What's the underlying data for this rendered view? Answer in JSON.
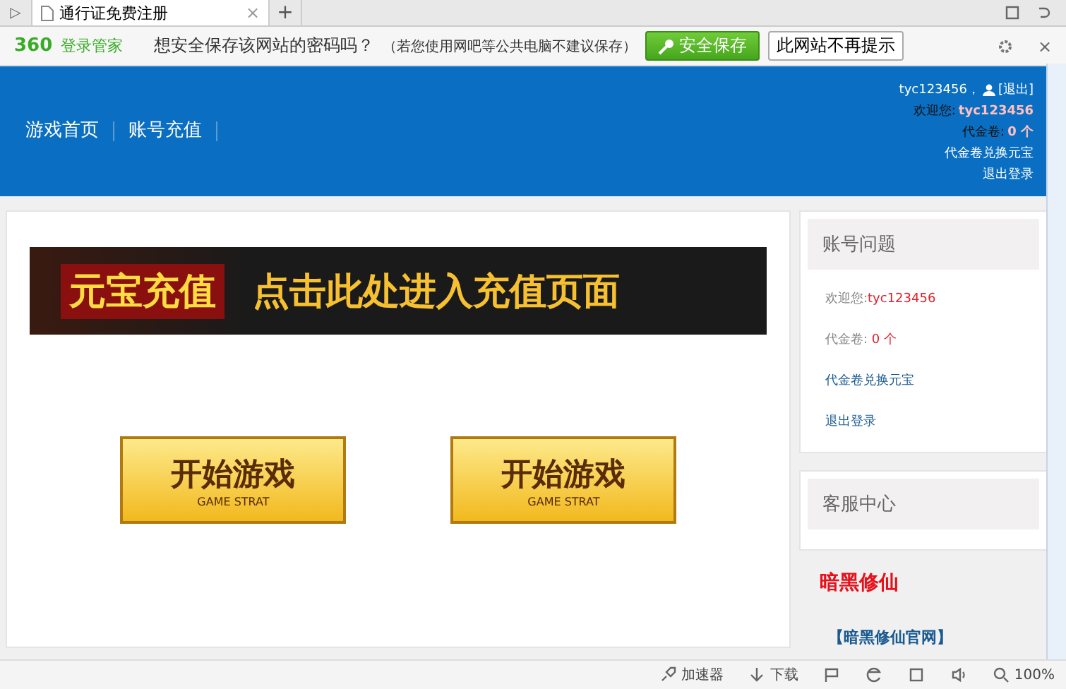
{
  "browser_tab": {
    "sidebar_toggle": "▷",
    "title": "通行证免费注册",
    "close": "×",
    "new_tab": "+"
  },
  "password_bar": {
    "brand_number": "360",
    "brand_name": "登录管家",
    "question": "想安全保存该网站的密码吗？",
    "hint": "（若您使用网吧等公共电脑不建议保存）",
    "save_button": "安全保存",
    "never_button": "此网站不再提示",
    "close": "×"
  },
  "header": {
    "nav": [
      {
        "label": "游戏首页"
      },
      {
        "label": "账号充值"
      }
    ],
    "user": "tyc123456，",
    "logout": "[退出]",
    "welcome_label": "欢迎您:",
    "welcome_user": "tyc123456",
    "voucher_label": "代金卷:",
    "voucher_value": "0 个",
    "exchange_link": "代金卷兑换元宝",
    "signout_link": "退出登录"
  },
  "main": {
    "banner": {
      "left": "元宝充值",
      "right": "点击此处进入充值页面"
    },
    "start_buttons": [
      {
        "title": "开始游戏",
        "subtitle": "GAME STRAT"
      },
      {
        "title": "开始游戏",
        "subtitle": "GAME STRAT"
      }
    ]
  },
  "sidebar": {
    "account_title": "账号问题",
    "welcome_label": "欢迎您:",
    "welcome_user": "tyc123456",
    "voucher_label": "代金卷:",
    "voucher_value": "0 个",
    "exchange_link": "代金卷兑换元宝",
    "signout_link": "退出登录",
    "service_title": "客服中心",
    "game_title": "暗黑修仙",
    "official_link": "【暗黑修仙官网】"
  },
  "status_bar": {
    "items": [
      {
        "label": "加速器"
      },
      {
        "label": "下载"
      }
    ],
    "zoom": "100%"
  }
}
